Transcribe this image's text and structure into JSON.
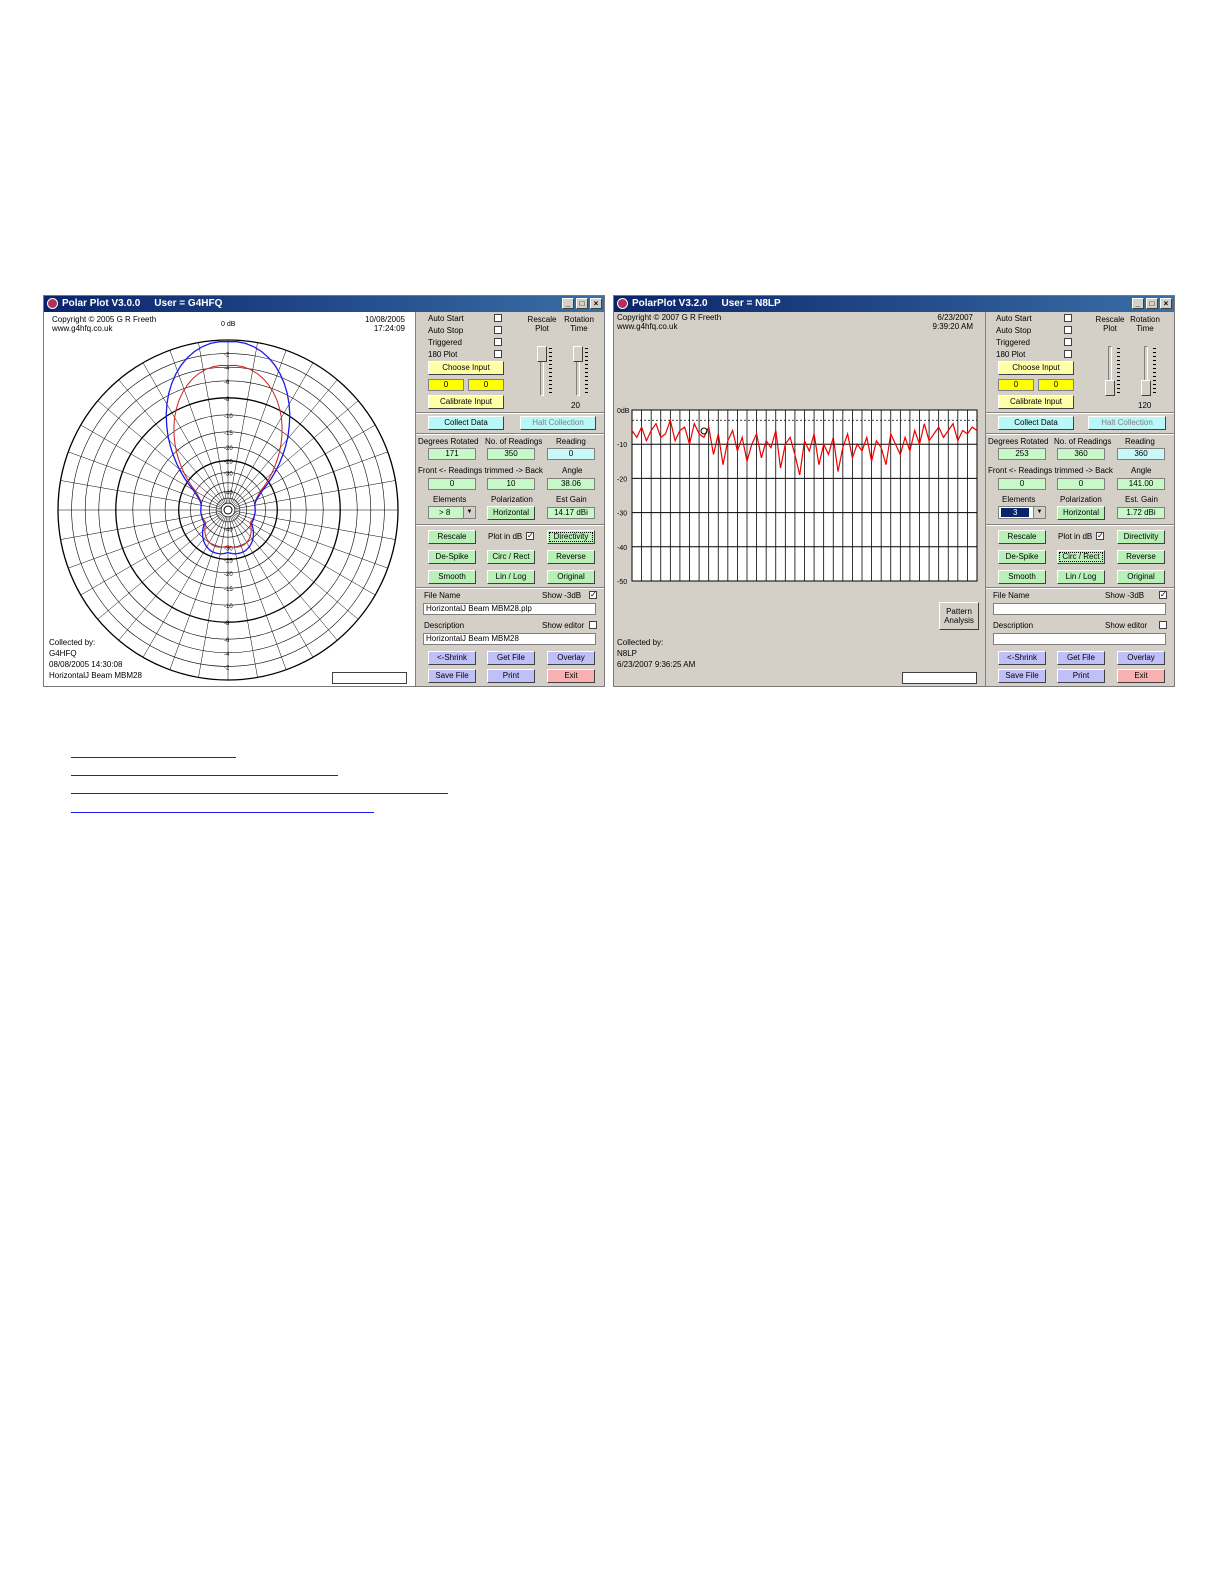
{
  "window1": {
    "title": "Polar Plot V3.0.0",
    "user": "User = G4HFQ",
    "copyright": "Copyright © 2005 G R Freeth",
    "website": "www.g4hfq.co.uk",
    "date": "10/08/2005",
    "time": "17:24:09",
    "zero_db_label": "0 dB",
    "collected_by_label": "Collected by:",
    "collector": "G4HFQ",
    "collected_datetime": "08/08/2005 14:30:08",
    "collected_description": "HorizontalJ Beam MBM28",
    "polar_ring_labels": [
      "-2",
      "-4",
      "-6",
      "-8",
      "-10",
      "-15",
      "-20",
      "-25",
      "-30",
      "-40"
    ],
    "controls": {
      "auto_start": "Auto Start",
      "auto_stop": "Auto Stop",
      "triggered": "Triggered",
      "plot180": "180 Plot",
      "rescale_plot": "Rescale Plot",
      "rotation_time": "Rotation Time",
      "rotation_time_value": "20",
      "choose_input": "Choose Input",
      "calibrate_input": "Calibrate Input",
      "input_a": "0",
      "input_b": "0",
      "collect_data": "Collect Data",
      "halt_collection": "Halt Collection",
      "degrees_rotated_label": "Degrees Rotated",
      "no_readings_label": "No. of Readings",
      "reading_label": "Reading",
      "degrees_rotated": "171",
      "no_readings": "350",
      "reading": "0",
      "trim_label": "Front <- Readings trimmed -> Back",
      "angle_label": "Angle",
      "front_trim": "0",
      "back_trim": "10",
      "angle": "38.06",
      "elements_label": "Elements",
      "polarization_label": "Polarization",
      "est_gain_label": "Est Gain",
      "elements": "> 8",
      "polarization": "Horizontal",
      "est_gain": "14.17 dBi",
      "rescale": "Rescale",
      "plot_in_db": "Plot in dB",
      "directivity": "Directivity",
      "despike": "De-Spike",
      "circ_rect": "Circ / Rect",
      "reverse": "Reverse",
      "smooth": "Smooth",
      "lin_log": "Lin / Log",
      "original": "Original",
      "file_name_label": "File Name",
      "show_3db": "Show -3dB",
      "file_name": "HorizontalJ Beam MBM28.plp",
      "description_label": "Description",
      "show_editor": "Show editor",
      "description": "HorizontalJ Beam MBM28",
      "shrink": "<-Shrink",
      "get_file": "Get File",
      "overlay": "Overlay",
      "save_file": "Save File",
      "print": "Print",
      "exit": "Exit"
    }
  },
  "window2": {
    "title": "PolarPlot V3.2.0",
    "user": "User = N8LP",
    "copyright": "Copyright © 2007 G R Freeth",
    "website": "www.g4hfq.co.uk",
    "date": "6/23/2007",
    "time": "9:39:20 AM",
    "collected_by_label": "Collected by:",
    "collector": "N8LP",
    "collected_datetime": "6/23/2007 9:36:25 AM",
    "pattern_analysis": "Pattern Analysis",
    "chart_data": {
      "type": "line",
      "ytick_labels": [
        "0dB",
        "-10",
        "-20",
        "-30",
        "-40",
        "-50"
      ],
      "ylim": [
        -50,
        0
      ],
      "xlim": [
        0,
        360
      ],
      "grid": true,
      "reference_line_db": -3,
      "series": [
        {
          "color": "#ee0000",
          "x": [
            0,
            5,
            10,
            15,
            20,
            25,
            30,
            35,
            40,
            45,
            50,
            55,
            60,
            65,
            70,
            75,
            80,
            85,
            90,
            95,
            100,
            105,
            110,
            115,
            120,
            125,
            130,
            135,
            140,
            145,
            150,
            155,
            160,
            165,
            170,
            175,
            180,
            185,
            190,
            195,
            200,
            205,
            210,
            215,
            220,
            225,
            230,
            235,
            240,
            245,
            250,
            255,
            260,
            265,
            270,
            275,
            280,
            285,
            290,
            295,
            300,
            305,
            310,
            315,
            320,
            325,
            330,
            335,
            340,
            345,
            350,
            355,
            360
          ],
          "y": [
            -6,
            -8,
            -5,
            -9,
            -6,
            -4,
            -8,
            -7,
            -3,
            -9,
            -6,
            -5,
            -10,
            -4,
            -7,
            -8,
            -5,
            -13,
            -7,
            -16,
            -9,
            -6,
            -12,
            -8,
            -15,
            -10,
            -7,
            -14,
            -9,
            -11,
            -6,
            -17,
            -10,
            -8,
            -13,
            -19,
            -9,
            -12,
            -7,
            -16,
            -10,
            -13,
            -8,
            -18,
            -11,
            -7,
            -14,
            -10,
            -12,
            -8,
            -15,
            -9,
            -11,
            -16,
            -7,
            -10,
            -13,
            -8,
            -12,
            -6,
            -10,
            -4,
            -9,
            -7,
            -5,
            -8,
            -6,
            -4,
            -9,
            -6,
            -7,
            -5,
            -6
          ]
        }
      ]
    },
    "controls": {
      "auto_start": "Auto Start",
      "auto_stop": "Auto Stop",
      "triggered": "Triggered",
      "plot180": "180 Plot",
      "rescale_plot": "Rescale Plot",
      "rotation_time": "Rotation Time",
      "rotation_time_value": "120",
      "choose_input": "Choose Input",
      "calibrate_input": "Calibrate Input",
      "input_a": "0",
      "input_b": "0",
      "collect_data": "Collect Data",
      "halt_collection": "Halt Collection",
      "degrees_rotated_label": "Degrees Rotated",
      "no_readings_label": "No. of Readings",
      "reading_label": "Reading",
      "degrees_rotated": "253",
      "no_readings": "360",
      "reading": "360",
      "trim_label": "Front <- Readings trimmed -> Back",
      "angle_label": "Angle",
      "front_trim": "0",
      "back_trim": "0",
      "angle": "141.00",
      "elements_label": "Elements",
      "polarization_label": "Polarization",
      "est_gain_label": "Est. Gain",
      "elements": "3",
      "polarization": "Horizontal",
      "est_gain": "1.72 dBi",
      "rescale": "Rescale",
      "plot_in_db": "Plot in dB",
      "directivity": "Directivity",
      "despike": "De-Spike",
      "circ_rect": "Circ / Rect",
      "reverse": "Reverse",
      "smooth": "Smooth",
      "lin_log": "Lin / Log",
      "original": "Original",
      "file_name_label": "File Name",
      "show_3db": "Show -3dB",
      "file_name": "",
      "description_label": "Description",
      "show_editor": "Show editor",
      "description": "",
      "shrink": "<-Shrink",
      "get_file": "Get File",
      "overlay": "Overlay",
      "save_file": "Save File",
      "print": "Print",
      "exit": "Exit"
    }
  },
  "links": [
    "",
    "",
    "",
    ""
  ],
  "colors": {
    "title_bar": "#0a246a",
    "main_lobe": "#1a1aee",
    "trace_red": "#ee0000",
    "link": "#1a1aee"
  }
}
